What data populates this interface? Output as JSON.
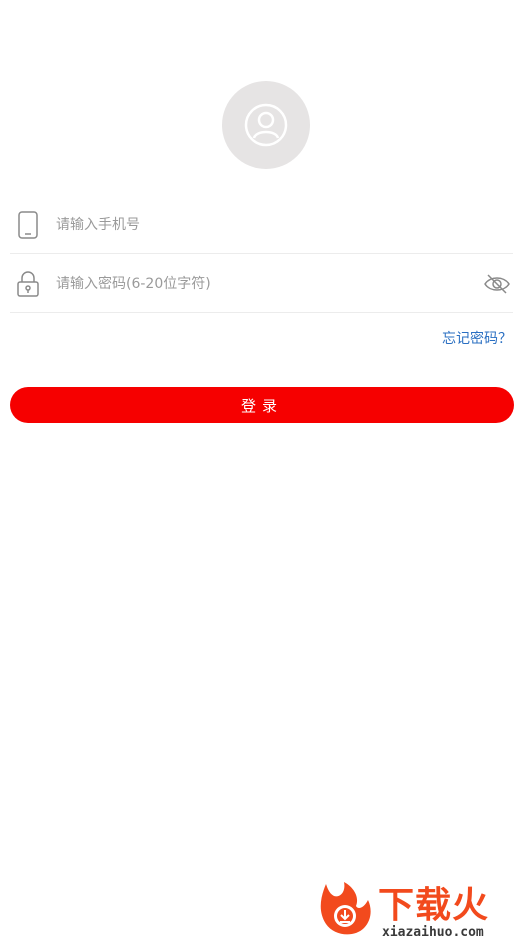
{
  "login": {
    "phone_placeholder": "请输入手机号",
    "password_placeholder": "请输入密码(6-20位字符)",
    "forgot_label": "忘记密码？",
    "login_label": "登录"
  },
  "watermark": {
    "brand": "下载火",
    "url": "xiazaihuo.com"
  },
  "icons": {
    "avatar": "user-avatar-icon",
    "phone": "phone-icon",
    "lock": "lock-icon",
    "eye": "eye-hidden-icon"
  },
  "colors": {
    "primary": "#f60000",
    "link": "#2a6fc2",
    "placeholder": "#9a9a9a"
  }
}
